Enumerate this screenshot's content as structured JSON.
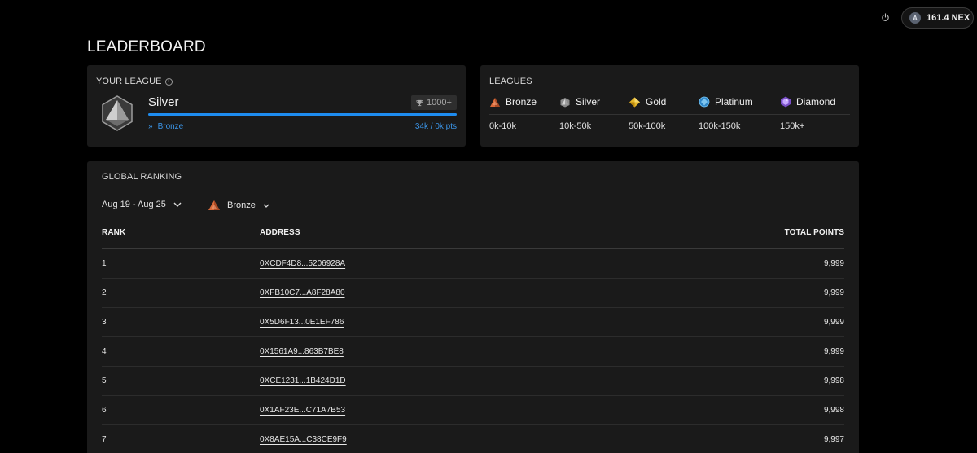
{
  "topbar": {
    "wallet_avatar_letter": "A",
    "wallet_balance": "161.4 NEX",
    "power_icon": "power-icon"
  },
  "page_title": "LEADERBOARD",
  "your_league": {
    "label": "YOUR LEAGUE",
    "current": "Silver",
    "trophy_count": "1000+",
    "progress_fraction": 1.0,
    "next_league": "Bronze",
    "points": "34k / 0k pts",
    "accent_color": "#1e8cf0"
  },
  "leagues": {
    "label": "LEAGUES",
    "items": [
      {
        "name": "Bronze",
        "range": "0k-10k",
        "icon": "bronze-gem-icon",
        "color": "#d96a3a"
      },
      {
        "name": "Silver",
        "range": "10k-50k",
        "icon": "silver-gem-icon",
        "color": "#b9b9b9"
      },
      {
        "name": "Gold",
        "range": "50k-100k",
        "icon": "gold-gem-icon",
        "color": "#e5b628"
      },
      {
        "name": "Platinum",
        "range": "100k-150k",
        "icon": "platinum-gem-icon",
        "color": "#49a9e0"
      },
      {
        "name": "Diamond",
        "range": "150k+",
        "icon": "diamond-gem-icon",
        "color": "#9a6de0"
      }
    ]
  },
  "ranking": {
    "label": "GLOBAL RANKING",
    "date_filter": "Aug 19 - Aug 25",
    "league_filter": "Bronze",
    "columns": {
      "rank": "RANK",
      "address": "ADDRESS",
      "points": "TOTAL POINTS"
    },
    "rows": [
      {
        "rank": "1",
        "address": "0XCDF4D8...5206928A",
        "points": "9,999"
      },
      {
        "rank": "2",
        "address": "0XFB10C7...A8F28A80",
        "points": "9,999"
      },
      {
        "rank": "3",
        "address": "0X5D6F13...0E1EF786",
        "points": "9,999"
      },
      {
        "rank": "4",
        "address": "0X1561A9...863B7BE8",
        "points": "9,999"
      },
      {
        "rank": "5",
        "address": "0XCE1231...1B424D1D",
        "points": "9,998"
      },
      {
        "rank": "6",
        "address": "0X1AF23E...C71A7B53",
        "points": "9,998"
      },
      {
        "rank": "7",
        "address": "0X8AE15A...C38CE9F9",
        "points": "9,997"
      }
    ]
  }
}
